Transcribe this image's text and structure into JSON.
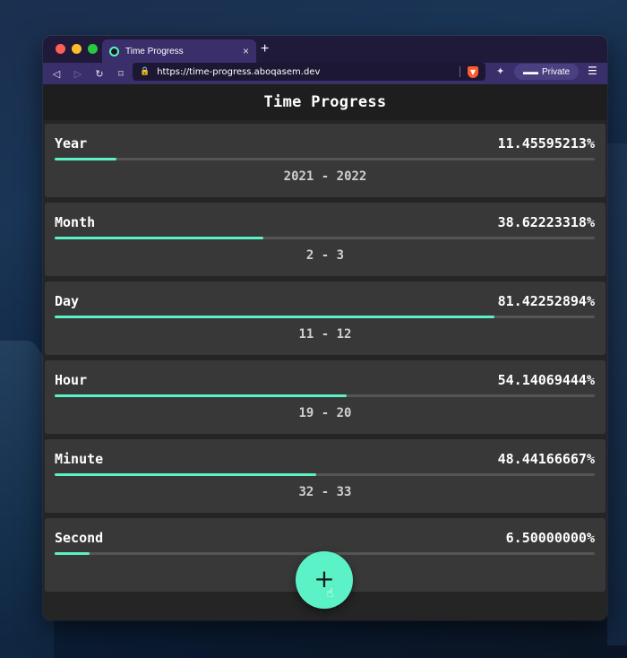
{
  "browser": {
    "tab_title": "Time Progress",
    "url": "https://time-progress.aboqasem.dev",
    "private_label": "Private",
    "tab_close": "×",
    "new_tab": "+",
    "back": "◁",
    "forward": "▷",
    "reload": "↻",
    "bookmark": "⌑",
    "menu": "☰",
    "lock": "🔒",
    "extensions": "✦",
    "glasses": "▬▬"
  },
  "page": {
    "title": "Time Progress",
    "fab_label": "+"
  },
  "progress_items": [
    {
      "label": "Year",
      "percent_text": "11.45595213%",
      "fraction": 0.1146,
      "range": "2021 - 2022"
    },
    {
      "label": "Month",
      "percent_text": "38.62223318%",
      "fraction": 0.3862,
      "range": "2 - 3"
    },
    {
      "label": "Day",
      "percent_text": "81.42252894%",
      "fraction": 0.8142,
      "range": "11 - 12"
    },
    {
      "label": "Hour",
      "percent_text": "54.14069444%",
      "fraction": 0.5414,
      "range": "19 - 20"
    },
    {
      "label": "Minute",
      "percent_text": "48.44166667%",
      "fraction": 0.4844,
      "range": "32 - 33"
    },
    {
      "label": "Second",
      "percent_text": "6.50000000%",
      "fraction": 0.065,
      "range": ""
    }
  ],
  "colors": {
    "accent": "#5cf2c8",
    "card_bg": "#383838",
    "page_bg": "#252525",
    "browser_chrome": "#3a2f6b"
  }
}
